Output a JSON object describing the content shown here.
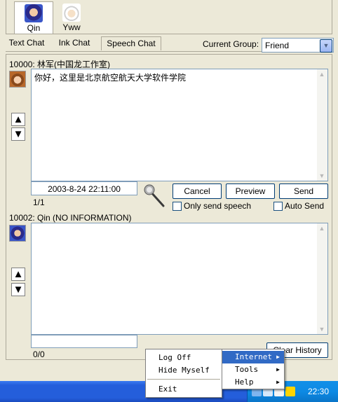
{
  "contacts": [
    {
      "name": "Qin",
      "selected": true
    },
    {
      "name": "Yww",
      "selected": false
    }
  ],
  "tabs": [
    {
      "label": "Text Chat",
      "active": false
    },
    {
      "label": "Ink Chat",
      "active": false
    },
    {
      "label": "Speech Chat",
      "active": true
    }
  ],
  "group": {
    "label": "Current Group:",
    "value": "Friend"
  },
  "incoming": {
    "header": "10000: 林军(中国龙工作室)",
    "message": "你好，这里是北京航空航天大学软件学院",
    "timestamp": "2003-8-24 22:11:00",
    "counter": "1/1"
  },
  "buttons": {
    "cancel": "Cancel",
    "preview": "Preview",
    "send": "Send",
    "clear_history": "Clear History"
  },
  "options": {
    "only_send_speech": "Only send speech",
    "auto_send": "Auto Send"
  },
  "self": {
    "header": "10002: Qin (NO INFORMATION)",
    "counter": "0/0"
  },
  "tray_menu": {
    "items": [
      "Log Off",
      "Hide Myself",
      "Exit"
    ]
  },
  "sub_menu": {
    "items": [
      "Internet",
      "Tools",
      "Help"
    ],
    "highlighted": "Internet"
  },
  "taskbar": {
    "clock": "22:30"
  },
  "colors": {
    "highlight": "#316ac5",
    "taskbar": "#245edb",
    "tray": "#0d8ae4",
    "textbox_border": "#7f9db9"
  }
}
